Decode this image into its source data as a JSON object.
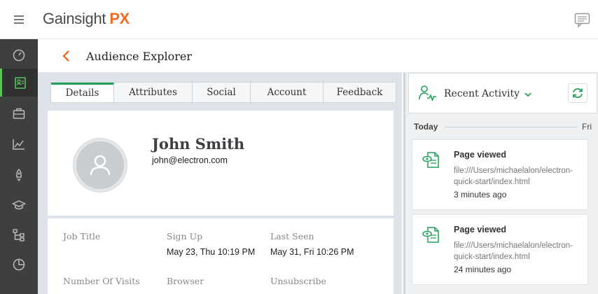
{
  "app": {
    "logo_text": "Gainsight",
    "logo_px": "PX"
  },
  "sidebar": {
    "items": [
      {
        "icon": "dashboard-icon"
      },
      {
        "icon": "audience-explorer-icon",
        "active": true
      },
      {
        "icon": "briefcase-icon"
      },
      {
        "icon": "analytics-icon"
      },
      {
        "icon": "rocket-icon"
      },
      {
        "icon": "graduation-cap-icon"
      },
      {
        "icon": "hierarchy-icon"
      },
      {
        "icon": "pie-chart-icon"
      }
    ]
  },
  "header": {
    "title": "Audience Explorer"
  },
  "tabs": [
    "Details",
    "Attributes",
    "Social",
    "Account",
    "Feedback"
  ],
  "profile": {
    "name": "John Smith",
    "email": "john@electron.com"
  },
  "info": {
    "job_title_label": "Job Title",
    "job_title_value": "",
    "sign_up_label": "Sign Up",
    "sign_up_value": "May 23, Thu 10:19 PM",
    "last_seen_label": "Last Seen",
    "last_seen_value": "May 31, Fri 10:26 PM",
    "visits_label": "Number Of Visits",
    "browser_label": "Browser",
    "unsubscribe_label": "Unsubscribe"
  },
  "activity": {
    "title": "Recent Activity",
    "day_label": "Today",
    "day_next": "Fri",
    "items": [
      {
        "kind": "Page viewed",
        "url": "file:///Users/michaelalon/electron-quick-start/index.html",
        "time": "3 minutes ago"
      },
      {
        "kind": "Page viewed",
        "url": "file:///Users/michaelalon/electron-quick-start/index.html",
        "time": "24 minutes ago"
      }
    ]
  },
  "colors": {
    "accent": "#22a05a",
    "brand_orange": "#f26b21",
    "sidebar_bg": "#3d3f41"
  }
}
